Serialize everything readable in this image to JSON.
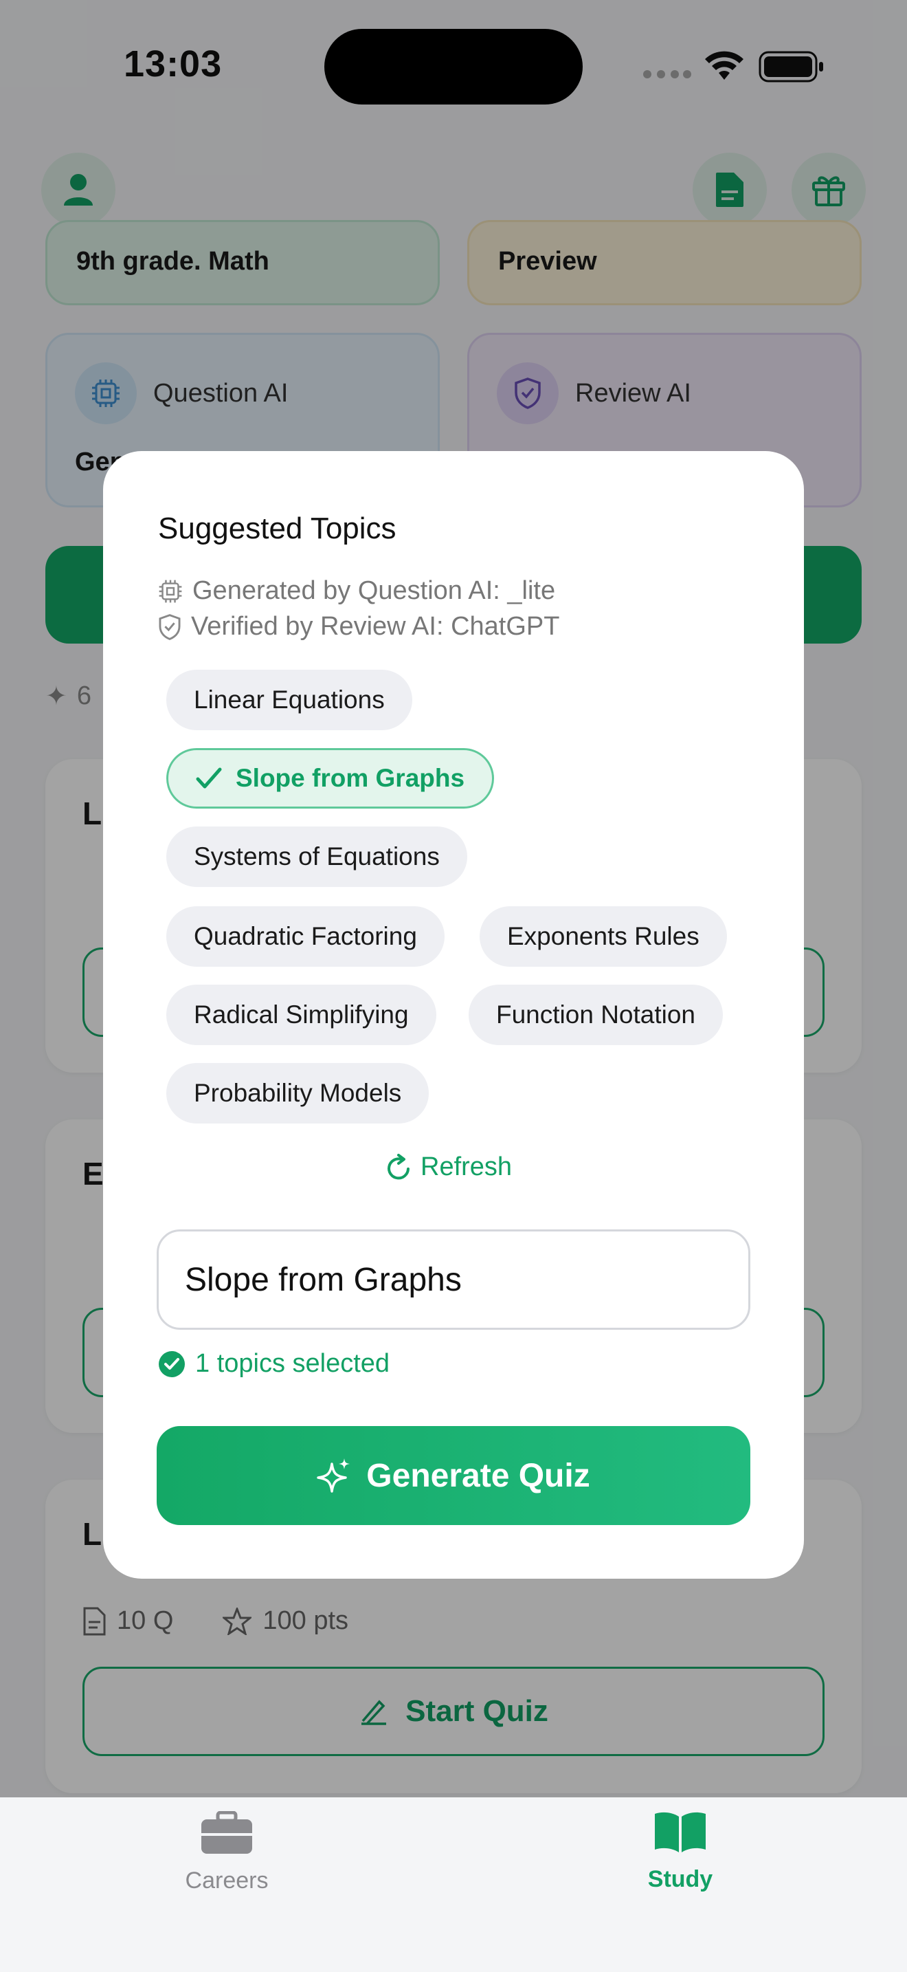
{
  "status_bar": {
    "time": "13:03"
  },
  "header": {
    "profile_icon": "person-icon",
    "doc_icon": "document-icon",
    "gift_icon": "gift-icon"
  },
  "background": {
    "grade_card": "9th grade. Math",
    "preview_card": "Preview",
    "question_ai_label": "Question AI",
    "question_ai_subtext": "Gen",
    "review_ai_label": "Review AI",
    "quiz_cards": [
      {
        "title_initial": "L"
      },
      {
        "title_initial": "E"
      },
      {
        "title_initial": "L",
        "questions": "10 Q",
        "points": "100 pts",
        "start_label": "Start Quiz"
      }
    ],
    "count_prefix": "6"
  },
  "modal": {
    "title": "Suggested Topics",
    "generated_by": "Generated by Question AI: _lite",
    "verified_by": "Verified by Review AI: ChatGPT",
    "topics": [
      "Linear Equations",
      "Slope from Graphs",
      "Systems of Equations",
      "Quadratic Factoring",
      "Exponents Rules",
      "Radical Simplifying",
      "Function Notation",
      "Probability Models"
    ],
    "selected_topic": "Slope from Graphs",
    "refresh_label": "Refresh",
    "input_value": "Slope from Graphs",
    "selection_count": "1 topics selected",
    "generate_label": "Generate Quiz"
  },
  "tabbar": {
    "tabs": [
      {
        "label": "Careers",
        "icon": "briefcase-icon",
        "active": false
      },
      {
        "label": "Study",
        "icon": "book-icon",
        "active": true
      }
    ]
  },
  "colors": {
    "accent": "#12a064",
    "overlay": "rgba(0,0,0,0.36)"
  }
}
